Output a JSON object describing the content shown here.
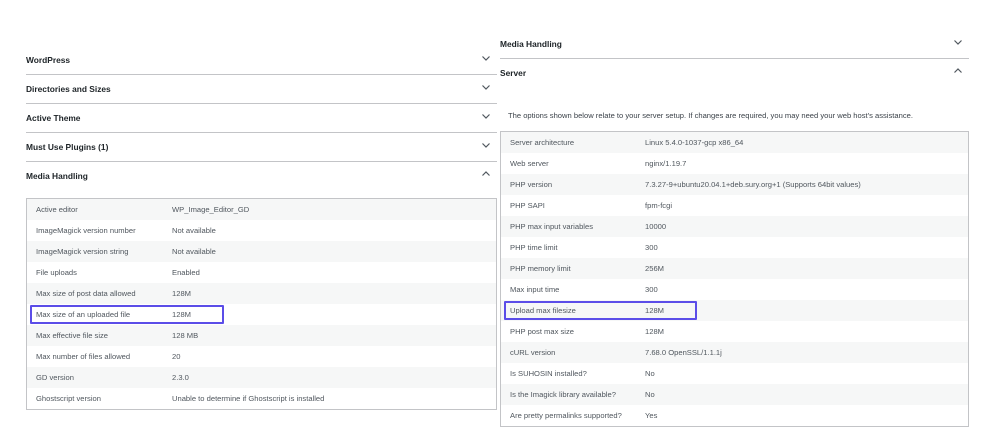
{
  "left_panel": {
    "sections": [
      {
        "label": "WordPress",
        "expanded": false
      },
      {
        "label": "Directories and Sizes",
        "expanded": false
      },
      {
        "label": "Active Theme",
        "expanded": false
      },
      {
        "label": "Must Use Plugins (1)",
        "expanded": false
      },
      {
        "label": "Media Handling",
        "expanded": true
      }
    ],
    "media_rows": [
      {
        "key": "Active editor",
        "value": "WP_Image_Editor_GD"
      },
      {
        "key": "ImageMagick version number",
        "value": "Not available"
      },
      {
        "key": "ImageMagick version string",
        "value": "Not available"
      },
      {
        "key": "File uploads",
        "value": "Enabled"
      },
      {
        "key": "Max size of post data allowed",
        "value": "128M"
      },
      {
        "key": "Max size of an uploaded file",
        "value": "128M",
        "highlighted": true
      },
      {
        "key": "Max effective file size",
        "value": "128 MB"
      },
      {
        "key": "Max number of files allowed",
        "value": "20"
      },
      {
        "key": "GD version",
        "value": "2.3.0"
      },
      {
        "key": "Ghostscript version",
        "value": "Unable to determine if Ghostscript is installed"
      }
    ]
  },
  "right_panel": {
    "sections": [
      {
        "label": "Media Handling",
        "expanded": false
      },
      {
        "label": "Server",
        "expanded": true
      }
    ],
    "server_intro": "The options shown below relate to your server setup. If changes are required, you may need your web host's assistance.",
    "server_rows": [
      {
        "key": "Server architecture",
        "value": "Linux 5.4.0-1037-gcp x86_64"
      },
      {
        "key": "Web server",
        "value": "nginx/1.19.7"
      },
      {
        "key": "PHP version",
        "value": "7.3.27-9+ubuntu20.04.1+deb.sury.org+1 (Supports 64bit values)"
      },
      {
        "key": "PHP SAPI",
        "value": "fpm-fcgi"
      },
      {
        "key": "PHP max input variables",
        "value": "10000"
      },
      {
        "key": "PHP time limit",
        "value": "300"
      },
      {
        "key": "PHP memory limit",
        "value": "256M"
      },
      {
        "key": "Max input time",
        "value": "300"
      },
      {
        "key": "Upload max filesize",
        "value": "128M",
        "highlighted": true
      },
      {
        "key": "PHP post max size",
        "value": "128M"
      },
      {
        "key": "cURL version",
        "value": "7.68.0 OpenSSL/1.1.1j"
      },
      {
        "key": "Is SUHOSIN installed?",
        "value": "No"
      },
      {
        "key": "Is the Imagick library available?",
        "value": "No"
      },
      {
        "key": "Are pretty permalinks supported?",
        "value": "Yes"
      }
    ]
  },
  "colors": {
    "highlight": "#5b4de8",
    "row_alt": "#f6f7f7",
    "border": "#c3c4c7"
  },
  "icons": {
    "collapsed": "chevron-down-icon",
    "expanded": "chevron-up-icon"
  }
}
